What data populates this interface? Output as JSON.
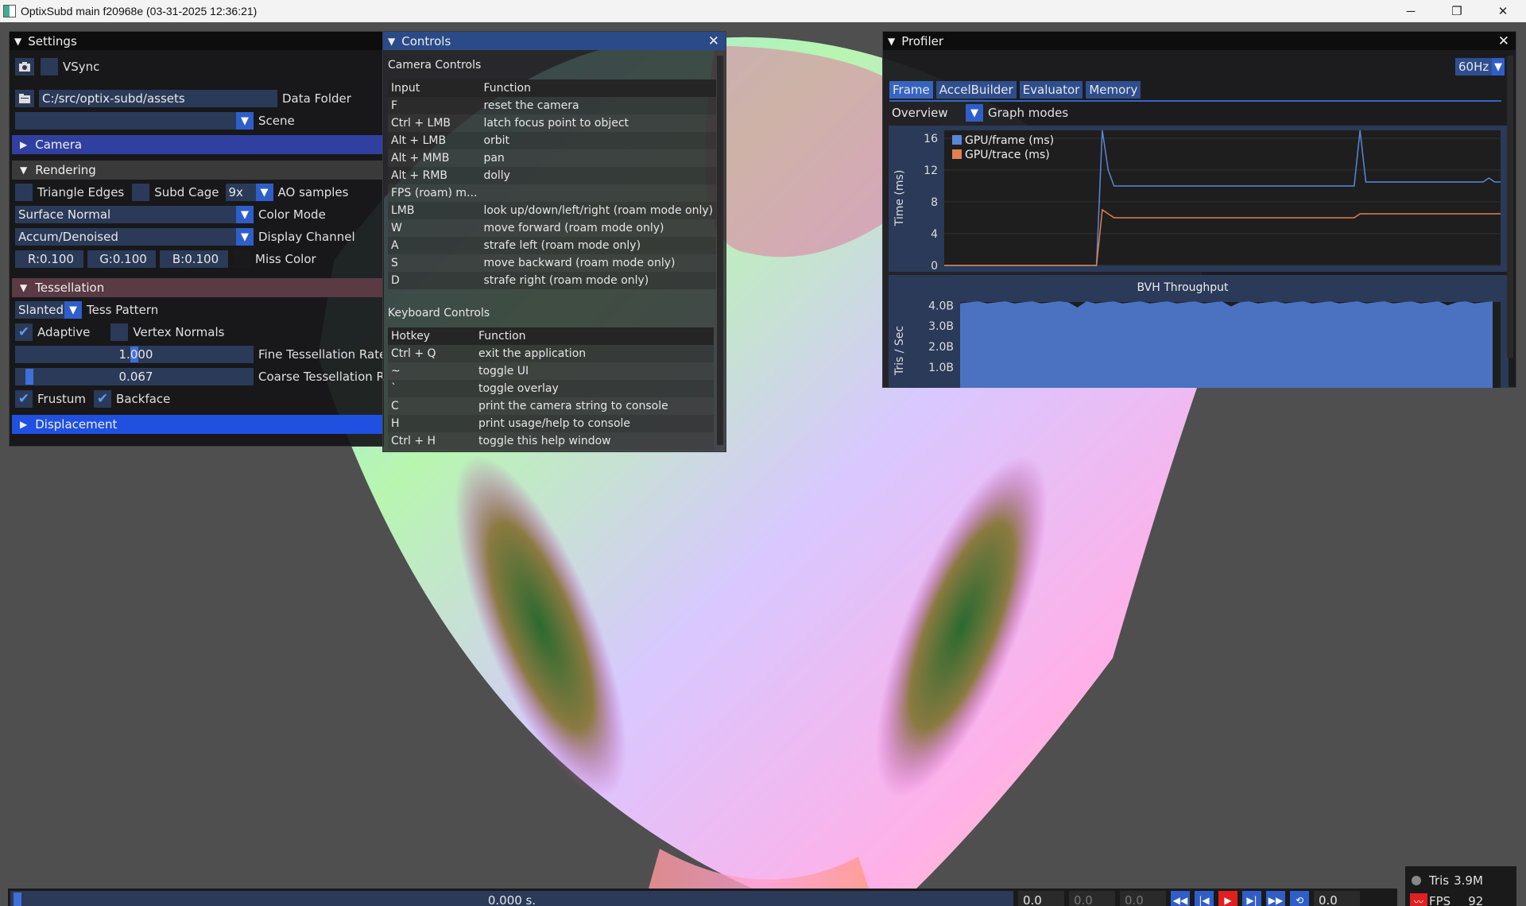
{
  "titlebar": {
    "title": "OptixSubd main f20968e (03-31-2025 12:36:21)",
    "minimize": "─",
    "restore": "❐",
    "close": "✕"
  },
  "settings": {
    "title": "Settings",
    "vsync_label": "VSync",
    "data_folder_value": "C:/src/optix-subd/assets",
    "data_folder_label": "Data Folder",
    "scene_value": "",
    "scene_label": "Scene",
    "camera_section": "Camera",
    "rendering_section": "Rendering",
    "triangle_edges": "Triangle Edges",
    "subd_cage": "Subd Cage",
    "ao_value": "9x",
    "ao_label": "AO samples",
    "color_mode_value": "Surface Normal",
    "color_mode_label": "Color Mode",
    "display_channel_value": "Accum/Denoised",
    "display_channel_label": "Display Channel",
    "miss_r": "R:0.100",
    "miss_g": "G:0.100",
    "miss_b": "B:0.100",
    "miss_label": "Miss Color",
    "tessellation_section": "Tessellation",
    "tess_pattern_value": "Slanted",
    "tess_pattern_label": "Tess Pattern",
    "adaptive": "Adaptive",
    "vertex_normals": "Vertex Normals",
    "fine_rate_value": "1.000",
    "fine_rate_label": "Fine Tessellation Rate",
    "fine_rate_fraction": 0.5,
    "coarse_rate_value": "0.067",
    "coarse_rate_label": "Coarse Tessellation Rate",
    "coarse_rate_fraction": 0.03,
    "frustum": "Frustum",
    "backface": "Backface",
    "displacement_section": "Displacement"
  },
  "controls": {
    "title": "Controls",
    "camera_heading": "Camera Controls",
    "camera_cols": [
      "Input",
      "Function"
    ],
    "camera_rows": [
      [
        "F",
        "reset the camera"
      ],
      [
        "Ctrl + LMB",
        "latch focus point to object"
      ],
      [
        "Alt + LMB",
        "orbit"
      ],
      [
        "Alt + MMB",
        "pan"
      ],
      [
        "Alt + RMB",
        "dolly"
      ],
      [
        "FPS (roam) m...",
        ""
      ],
      [
        "LMB",
        "look up/down/left/right (roam mode only)"
      ],
      [
        "W",
        "move forward (roam mode only)"
      ],
      [
        "A",
        "strafe left (roam mode only)"
      ],
      [
        "S",
        "move backward (roam mode only)"
      ],
      [
        "D",
        "strafe right (roam mode only)"
      ]
    ],
    "keyboard_heading": "Keyboard Controls",
    "keyboard_cols": [
      "Hotkey",
      "Function"
    ],
    "keyboard_rows": [
      [
        "Ctrl + Q",
        "exit the application"
      ],
      [
        "~",
        "toggle UI"
      ],
      [
        "`",
        "toggle overlay"
      ],
      [
        "C",
        "print the camera string to console"
      ],
      [
        "H",
        "print usage/help to console"
      ],
      [
        "Ctrl + H",
        "toggle this help window"
      ]
    ]
  },
  "profiler": {
    "title": "Profiler",
    "rate": "60Hz",
    "tabs": [
      "Frame",
      "AccelBuilder",
      "Evaluator",
      "Memory"
    ],
    "overview": "Overview",
    "graph_modes": "Graph modes",
    "throughput_title": "BVH Throughput"
  },
  "chart_data": [
    {
      "type": "line",
      "title": "",
      "ylabel": "Time (ms)",
      "ylim": [
        0,
        17
      ],
      "yticks": [
        0,
        4,
        8,
        12,
        16
      ],
      "legend_position": "top-left",
      "series": [
        {
          "name": "GPU/frame (ms)",
          "color": "#5a86d8",
          "values": [
            0,
            0,
            0,
            0,
            0,
            0,
            0,
            0,
            0,
            0,
            0,
            0,
            0,
            0,
            0,
            0,
            0,
            0,
            0,
            0,
            0,
            0,
            0,
            0,
            0,
            0,
            0,
            17,
            12,
            10,
            10,
            10,
            10,
            10,
            10,
            10,
            10,
            10,
            10,
            10,
            10,
            10,
            10,
            10,
            10,
            10,
            10,
            10,
            10,
            10,
            10,
            10,
            10,
            10,
            10,
            10,
            10,
            10,
            10,
            10,
            10,
            10,
            10,
            10,
            10,
            10,
            10,
            10,
            10,
            10,
            10,
            17,
            10.5,
            10.5,
            10.5,
            10.5,
            10.5,
            10.5,
            10.5,
            10.5,
            10.5,
            10.5,
            10.5,
            10.5,
            10.5,
            10.5,
            10.5,
            10.5,
            10.5,
            10.5,
            10.5,
            10.5,
            10.5,
            11,
            10.5,
            10.5
          ]
        },
        {
          "name": "GPU/trace (ms)",
          "color": "#e08050",
          "values": [
            0,
            0,
            0,
            0,
            0,
            0,
            0,
            0,
            0,
            0,
            0,
            0,
            0,
            0,
            0,
            0,
            0,
            0,
            0,
            0,
            0,
            0,
            0,
            0,
            0,
            0,
            0,
            7,
            6.5,
            6,
            6,
            6,
            6,
            6,
            6,
            6,
            6,
            6,
            6,
            6,
            6,
            6,
            6,
            6,
            6,
            6,
            6,
            6,
            6,
            6,
            6,
            6,
            6,
            6,
            6,
            6,
            6,
            6,
            6,
            6,
            6,
            6,
            6,
            6,
            6,
            6,
            6,
            6,
            6,
            6,
            6,
            6.5,
            6.5,
            6.5,
            6.5,
            6.5,
            6.5,
            6.5,
            6.5,
            6.5,
            6.5,
            6.5,
            6.5,
            6.5,
            6.5,
            6.5,
            6.5,
            6.5,
            6.5,
            6.5,
            6.5,
            6.5,
            6.5,
            6.5,
            6.5,
            6.5
          ]
        }
      ]
    },
    {
      "type": "area",
      "title": "BVH Throughput",
      "ylabel": "Tris / Sec",
      "yticks": [
        "1.0B",
        "2.0B",
        "3.0B",
        "4.0B"
      ],
      "ylim": [
        0,
        4.5
      ],
      "series": [
        {
          "name": "",
          "color": "#4a72c0",
          "values": [
            4.1,
            4.15,
            4.2,
            4.1,
            4.15,
            4.2,
            4.1,
            4.15,
            4.2,
            4.1,
            4.15,
            4.2,
            4.15,
            3.9,
            4.2,
            4.1,
            4.15,
            4.2,
            4.1,
            4.15,
            4.2,
            4.1,
            4.15,
            4.2,
            4.1,
            4.15,
            4.2,
            4.1,
            4.15,
            4.2,
            3.95,
            4.15,
            4.2,
            4.1,
            4.15,
            4.2,
            4.1,
            4.15,
            4.2,
            4.1,
            4.15,
            4.2,
            4.1,
            4.15,
            4.2,
            4.1,
            4.15,
            4.2,
            4.1,
            4.15,
            4.2,
            4.1,
            4.15,
            4.2,
            4.0,
            4.15,
            4.2,
            4.1,
            4.15,
            4.2
          ]
        }
      ]
    }
  ],
  "timeline": {
    "time": "0.000 s.",
    "v1": "0.0",
    "v2": "0.0",
    "v3": "0.0",
    "v4": "0.0",
    "fraction": 0.0
  },
  "stats": {
    "tris_label": "Tris",
    "tris_value": "3.9M",
    "fps_label": "FPS",
    "fps_value": "92"
  }
}
